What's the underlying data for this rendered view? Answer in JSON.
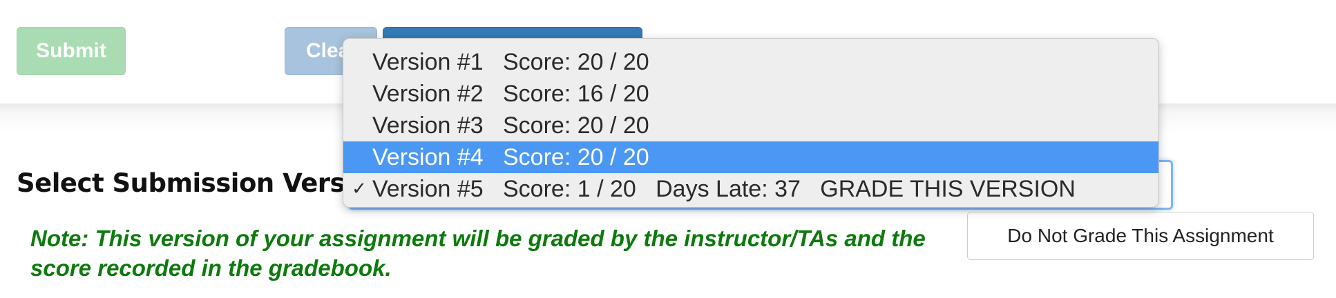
{
  "toolbar": {
    "submit_label": "Submit",
    "clear_label": "Clear"
  },
  "main": {
    "select_label": "Select Submission Version:",
    "note": "Note: This version of your assignment will be graded by the instructor/TAs and the score recorded in the gradebook.",
    "do_not_grade_label": "Do Not Grade This Assignment"
  },
  "dropdown": {
    "options": [
      {
        "label": "Version #1   Score: 20 / 20",
        "highlighted": false,
        "checked": false
      },
      {
        "label": "Version #2   Score: 16 / 20",
        "highlighted": false,
        "checked": false
      },
      {
        "label": "Version #3   Score: 20 / 20",
        "highlighted": false,
        "checked": false
      },
      {
        "label": "Version #4   Score: 20 / 20",
        "highlighted": true,
        "checked": false
      },
      {
        "label": "Version #5   Score: 1 / 20   Days Late: 37   GRADE THIS VERSION",
        "highlighted": false,
        "checked": true
      }
    ],
    "check_glyph": "✓",
    "highlight_color": "#4b97f4"
  },
  "colors": {
    "submit_button": "#a9dcb2",
    "clear_button": "#a8c3dd",
    "primary_button": "#337ab7",
    "note_text": "#0c7a0c"
  }
}
